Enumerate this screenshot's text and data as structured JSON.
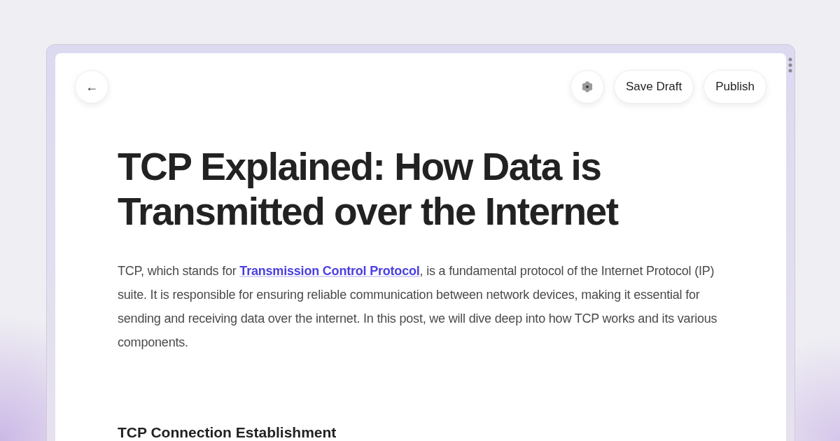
{
  "toolbar": {
    "back_button": {
      "icon": "←"
    },
    "buttons": [
      {
        "label": "Save Draft"
      },
      {
        "label": "Publish"
      }
    ]
  },
  "article": {
    "title": "TCP Explained: How Data is Transmitted over the Internet",
    "intro": {
      "before": "TCP, which stands for ",
      "link": "Transmission Control Protocol",
      "after": ", is a fundamental protocol of the Internet Protocol (IP) suite. It is responsible for ensuring reliable communication between network devices, making it essential for sending and receiving data over the internet. In this post, we will dive deep into how TCP works and its various components."
    },
    "section_heading": "TCP Connection Establishment"
  }
}
